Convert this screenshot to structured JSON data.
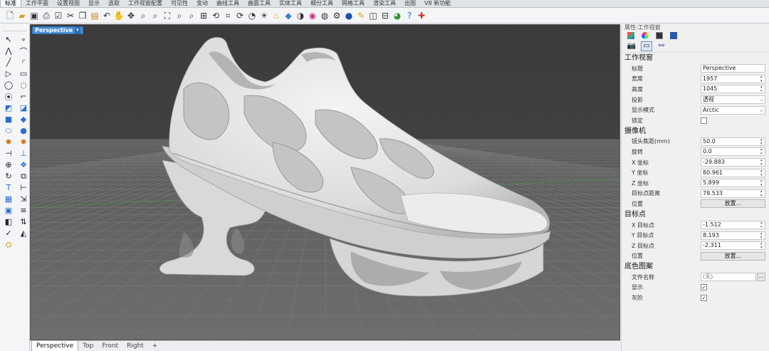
{
  "top_tabs": [
    "标准",
    "工作平面",
    "设置视图",
    "显示",
    "选取",
    "工作视窗配置",
    "可见性",
    "变动",
    "曲线工具",
    "曲面工具",
    "实体工具",
    "细分工具",
    "网格工具",
    "渲染工具",
    "出图",
    "V8 新功能"
  ],
  "toolbar_icons": [
    "new-file-icon",
    "open-folder-icon",
    "save-icon",
    "print-icon",
    "properties-icon",
    "cut-icon",
    "copy-icon",
    "paste-icon",
    "pan-hand-icon",
    "move-view-icon",
    "zoom-icon",
    "zoom-window-icon",
    "zoom-extents-icon",
    "zoom-selected-icon",
    "four-viewports-icon",
    "rotate-view-icon",
    "grid-snap-icon",
    "undo-view-icon",
    "material-icon",
    "shade-icon",
    "color-wheel-icon",
    "display-mode-icon",
    "render-icon",
    "light-icon",
    "globe-icon",
    "help-icon",
    "plugin-icon"
  ],
  "viewport": {
    "title": "Perspective",
    "background_color": "#3f3f3f",
    "model_color": "#e4e5e6"
  },
  "viewport_tabs": [
    "Perspective",
    "Top",
    "Front",
    "Right"
  ],
  "viewport_add": "+",
  "panel": {
    "title": "属性:工作视窗",
    "sections": {
      "viewport": {
        "heading": "工作视窗",
        "title_label": "标题",
        "title_value": "Perspective",
        "width_label": "宽度",
        "width_value": "1957",
        "height_label": "高度",
        "height_value": "1045",
        "projection_label": "投影",
        "projection_value": "透视",
        "display_label": "显示模式",
        "display_value": "Arctic",
        "lock_label": "锁定"
      },
      "camera": {
        "heading": "摄像机",
        "focal_label": "镜头焦距(mm)",
        "focal_value": "50.0",
        "rotation_label": "旋转",
        "rotation_value": "0.0",
        "x_label": "X 坐标",
        "x_value": "-29.883",
        "y_label": "Y 坐标",
        "y_value": "80.961",
        "z_label": "Z 坐标",
        "z_value": "5.899",
        "dist_label": "目标点距离",
        "dist_value": "78.533",
        "pos_label": "位置",
        "place_button": "放置..."
      },
      "target": {
        "heading": "目标点",
        "x_label": "X 目标点",
        "x_value": "-1.512",
        "y_label": "Y 目标点",
        "y_value": "8.193",
        "z_label": "Z 目标点",
        "z_value": "-2.311",
        "pos_label": "位置",
        "place_button": "放置..."
      },
      "background": {
        "heading": "底色图案",
        "file_label": "文件名称",
        "file_value": "(无)",
        "browse": "...",
        "show_label": "显示",
        "gray_label": "灰阶",
        "check": "✓"
      }
    }
  }
}
